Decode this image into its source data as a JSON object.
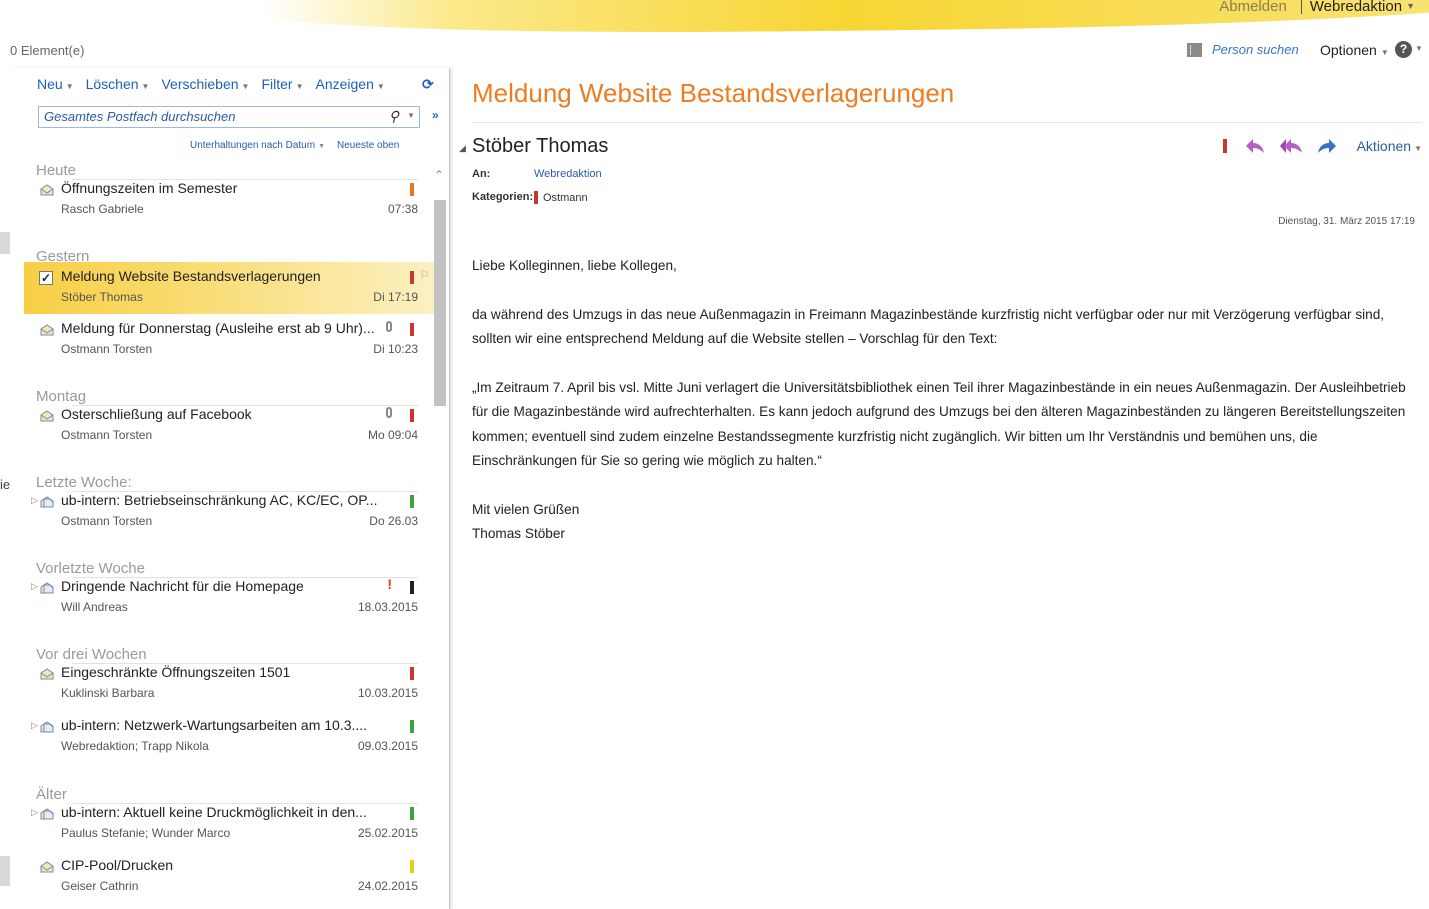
{
  "top": {
    "signout_label": "Abmelden",
    "user_label": "Webredaktion",
    "caret": "▼"
  },
  "header": {
    "item_count": "0 Element(e)",
    "person_search_label": "Person suchen",
    "options_label": "Optionen",
    "help_label": "?"
  },
  "nav_strip": {
    "partial_text": "ie"
  },
  "toolbar": {
    "new_label": "Neu",
    "delete_label": "Löschen",
    "move_label": "Verschieben",
    "filter_label": "Filter",
    "view_label": "Anzeigen"
  },
  "search": {
    "placeholder": "Gesamtes Postfach durchsuchen"
  },
  "sort": {
    "conversations_label": "Unterhaltungen nach Datum",
    "order_label": "Neueste oben"
  },
  "groups": [
    {
      "label": "Heute"
    },
    {
      "label": "Gestern"
    },
    {
      "label": "Montag"
    },
    {
      "label": "Letzte Woche:"
    },
    {
      "label": "Vorletzte Woche"
    },
    {
      "label": "Vor drei Wochen"
    },
    {
      "label": "Älter"
    }
  ],
  "messages": [
    {
      "subject": "Öffnungszeiten im Semester",
      "sender": "Rasch Gabriele",
      "date": "07:38",
      "category_color": "#e8742b"
    },
    {
      "subject": "Meldung Website Bestandsverlagerungen",
      "sender": "Stöber Thomas",
      "date": "Di 17:19",
      "category_color": "#c9372c",
      "selected": true
    },
    {
      "subject": "Meldung für Donnerstag (Ausleihe erst ab 9 Uhr)...",
      "sender": "Ostmann Torsten",
      "date": "Di 10:23",
      "category_color": "#c9372c",
      "attachment": true
    },
    {
      "subject": "Osterschließung auf Facebook",
      "sender": "Ostmann Torsten",
      "date": "Mo 09:04",
      "category_color": "#c9372c",
      "attachment": true
    },
    {
      "subject": "ub-intern: Betriebseinschränkung AC, KC/EC, OP...",
      "sender": "Ostmann Torsten",
      "date": "Do 26.03",
      "category_color": "#3fa33c",
      "conversation": true
    },
    {
      "subject": "Dringende Nachricht für die Homepage",
      "sender": "Will Andreas",
      "date": "18.03.2015",
      "category_color": "#222222",
      "conversation": true,
      "important": true
    },
    {
      "subject": "Eingeschränkte Öffnungszeiten 1501",
      "sender": "Kuklinski Barbara",
      "date": "10.03.2015",
      "category_color": "#c9372c"
    },
    {
      "subject": "ub-intern: Netzwerk-Wartungsarbeiten am 10.3....",
      "sender": "Webredaktion; Trapp Nikola",
      "date": "09.03.2015",
      "category_color": "#3fa33c",
      "conversation": true
    },
    {
      "subject": "ub-intern: Aktuell keine Druckmöglichkeit in den...",
      "sender": "Paulus Stefanie; Wunder Marco",
      "date": "25.02.2015",
      "category_color": "#3fa33c",
      "conversation": true
    },
    {
      "subject": "CIP-Pool/Drucken",
      "sender": "Geiser Cathrin",
      "date": "24.02.2015",
      "category_color": "#e6cf1a"
    }
  ],
  "reading": {
    "subject": "Meldung Website Bestandsverlagerungen",
    "sender": "Stöber Thomas",
    "to_label": "An:",
    "to_value": "Webredaktion",
    "categories_label": "Kategorien:",
    "categories_value": "Ostmann",
    "category_color": "#c9372c",
    "date": "Dienstag, 31. März 2015 17:19",
    "actions_label": "Aktionen",
    "body": [
      "Liebe Kolleginnen, liebe Kollegen,",
      "da während des Umzugs in das neue Außenmagazin in Freimann Magazinbestände kurzfristig nicht verfügbar oder nur mit Verzögerung verfügbar sind, sollten wir eine entsprechend Meldung auf die Website stellen – Vorschlag für den Text:",
      "„Im Zeitraum 7. April bis vsl. Mitte Juni verlagert die Universitätsbibliothek einen Teil ihrer Magazinbestände in ein neues Außenmagazin. Der Ausleihbetrieb für die Magazinbestände wird aufrechterhalten. Es kann jedoch aufgrund des Umzugs bei den älteren Magazinbeständen zu längeren Bereitstellungszeiten kommen; eventuell sind zudem einzelne Bestandssegmente kurzfristig nicht zugänglich. Wir bitten um Ihr Verständnis und bemühen uns, die Einschränkungen für Sie so gering wie möglich zu halten.“",
      "Mit vielen Grüßen",
      "Thomas Stöber"
    ]
  }
}
